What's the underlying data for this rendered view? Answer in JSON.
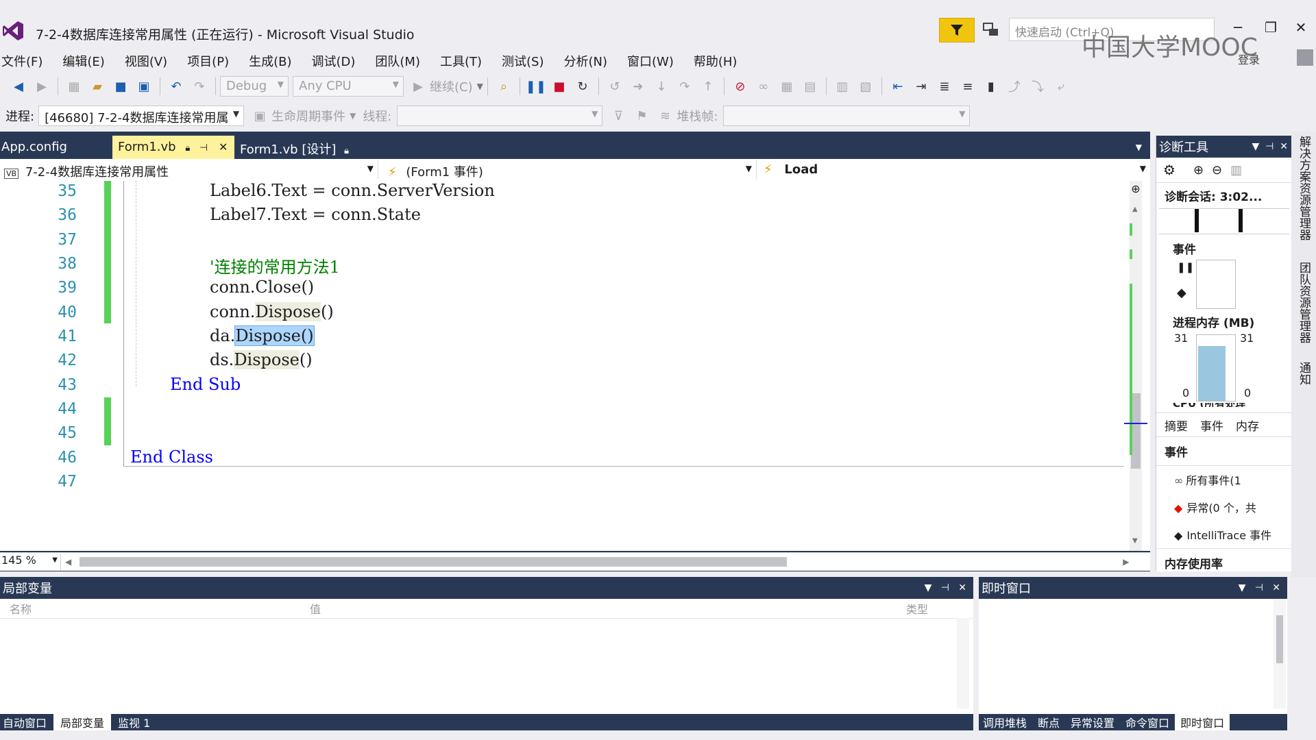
{
  "window": {
    "title": "7-2-4数据库连接常用属性 (正在运行) - Microsoft Visual Studio",
    "quick_launch_placeholder": "快速启动 (Ctrl+Q)",
    "watermark": "中国大学MOOC",
    "login": "登录"
  },
  "menu": [
    "文件(F)",
    "编辑(E)",
    "视图(V)",
    "项目(P)",
    "生成(B)",
    "调试(D)",
    "团队(M)",
    "工具(T)",
    "测试(S)",
    "分析(N)",
    "窗口(W)",
    "帮助(H)"
  ],
  "toolbar": {
    "config": "Debug",
    "platform": "Any CPU",
    "continue": "继续(C)",
    "process_label": "进程:",
    "process_value": "[46680] 7-2-4数据库连接常用属",
    "lifecycle": "生命周期事件",
    "thread_label": "线程:",
    "stackframe_label": "堆栈帧:"
  },
  "tabs": [
    {
      "label": "App.config"
    },
    {
      "label": "Form1.vb"
    },
    {
      "label": "Form1.vb [设计]"
    }
  ],
  "navbar": {
    "project": "7-2-4数据库连接常用属性",
    "object": "(Form1 事件)",
    "member": "Load"
  },
  "code": {
    "lines": [
      "35",
      "36",
      "37",
      "38",
      "39",
      "40",
      "41",
      "42",
      "43",
      "44",
      "45",
      "46",
      "47"
    ],
    "l35a": "Label6.Text = conn.ServerVersion",
    "l36a": "Label7.Text = conn.State",
    "l38": "'连接的常用方法1",
    "l39": "conn.Close()",
    "l40a": "conn.",
    "l40b": "Dispose",
    "l40c": "()",
    "l41a": "da.",
    "l41b": "Dispose()",
    "l42a": "ds.",
    "l42b": "Dispose",
    "l42c": "()",
    "l43a": "End",
    "l43b": " Sub",
    "l46a": "End",
    "l46b": " Class"
  },
  "zoom": "145 %",
  "locals": {
    "title": "局部变量",
    "col_name": "名称",
    "col_value": "值",
    "col_type": "类型",
    "bottom_tabs": [
      "自动窗口",
      "局部变量",
      "监视 1"
    ]
  },
  "immediate": {
    "title": "即时窗口",
    "bottom_tabs": [
      "调用堆栈",
      "断点",
      "异常设置",
      "命令窗口",
      "即时窗口"
    ]
  },
  "diag": {
    "title": "诊断工具",
    "session": "诊断会话: 3:02...",
    "events_header": "事件",
    "memory_header": "进程内存 (MB)",
    "mem_max_left": "31",
    "mem_max_right": "31",
    "mem_min_left": "0",
    "mem_min_right": "0",
    "mem_level": 0.85,
    "cpu_partial": "CPU (所有处理",
    "tabs": [
      "摘要",
      "事件",
      "内存"
    ],
    "events_section": "事件",
    "all_events": "所有事件(1",
    "exceptions": "异常(0 个，共",
    "intellitrace": "IntelliTrace 事件",
    "memory_usage": "内存使用率"
  },
  "side_rail": [
    "解决方案资源管理器",
    "团队资源管理器",
    "通知"
  ],
  "colors": {
    "accent": "#293955",
    "active_tab": "#fff29d",
    "keyword": "#0000ff",
    "comment": "#008000",
    "line_number": "#2b91af"
  }
}
